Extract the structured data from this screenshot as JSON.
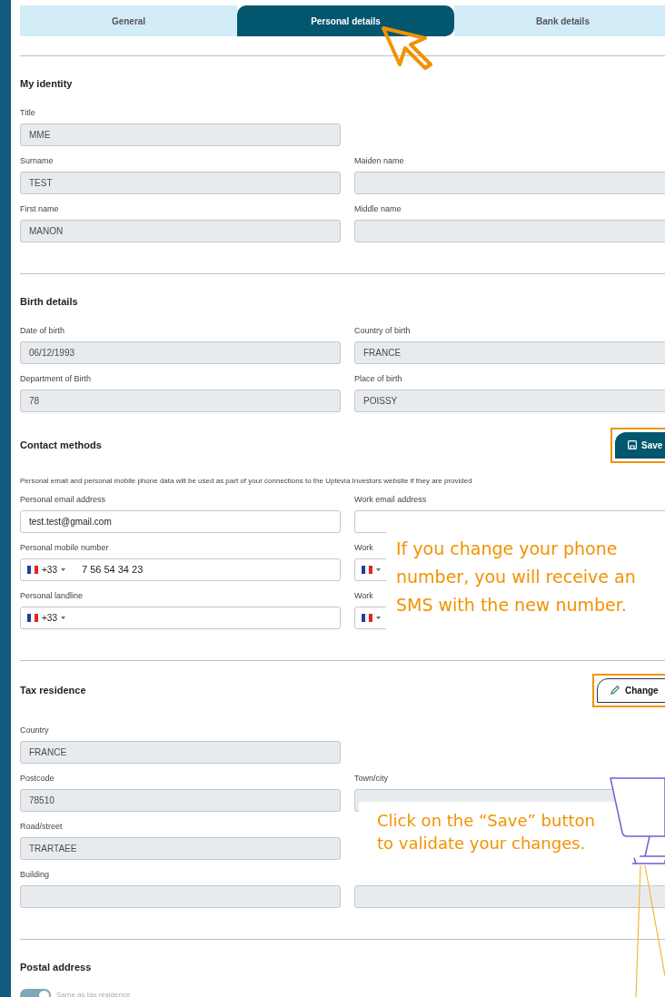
{
  "tabs": [
    {
      "label": "General",
      "selected": false
    },
    {
      "label": "Personal details",
      "selected": true
    },
    {
      "label": "Bank details",
      "selected": false
    }
  ],
  "sections": [
    {
      "title": "My identity",
      "divider": true,
      "rows": [
        {
          "left": {
            "kind": "text",
            "label": "Title",
            "value": "MME",
            "disabled": true
          }
        },
        {
          "left": {
            "kind": "text",
            "label": "Surname",
            "value": "TEST",
            "disabled": true
          },
          "right": {
            "kind": "text",
            "label": "Maiden name",
            "disabled": true
          }
        },
        {
          "left": {
            "kind": "text",
            "label": "First name",
            "value": "MANON",
            "disabled": true
          },
          "right": {
            "kind": "text",
            "label": "Middle name",
            "disabled": true
          }
        }
      ]
    },
    {
      "title": "Birth details",
      "divider": true,
      "rows": [
        {
          "left": {
            "kind": "text",
            "label": "Date of birth",
            "value": "06/12/1993",
            "disabled": true
          },
          "right": {
            "kind": "text",
            "label": "Country of birth",
            "value": "FRANCE",
            "disabled": true
          }
        },
        {
          "left": {
            "kind": "text",
            "label": "Department of Birth",
            "value": "78",
            "disabled": true
          },
          "right": {
            "kind": "text",
            "label": "Place of birth",
            "value": "POISSY",
            "disabled": true
          }
        }
      ]
    },
    {
      "title": "Contact methods",
      "action": {
        "kind": "save",
        "label": "Save",
        "highlighted": true
      },
      "note": "Personal email and personal mobile phone data will be used as part of your connections to the Uptevia Investors website if they are provided",
      "rows": [
        {
          "left": {
            "kind": "text",
            "label": "Personal email address",
            "value": "test.test@gmail.com",
            "disabled": false
          },
          "right": {
            "kind": "text",
            "label": "Work email address",
            "disabled": false
          }
        },
        {
          "left": {
            "kind": "phone",
            "label": "Personal mobile number",
            "dial": "+33",
            "value": "7 56 54 34 23",
            "disabled": false
          },
          "right": {
            "kind": "phone",
            "label": "Work",
            "disabled": false
          }
        },
        {
          "left": {
            "kind": "phone",
            "label": "Personal landline",
            "dial": "+33",
            "disabled": false
          },
          "right": {
            "kind": "phone",
            "label": "Work",
            "disabled": false
          }
        }
      ]
    },
    {
      "title": "Tax residence",
      "divider": true,
      "action": {
        "kind": "change",
        "label": "Change",
        "highlighted": true
      },
      "rows": [
        {
          "left": {
            "kind": "text",
            "label": "Country",
            "value": "FRANCE",
            "disabled": true
          }
        },
        {
          "left": {
            "kind": "text",
            "label": "Postcode",
            "value": "78510",
            "disabled": true
          },
          "right": {
            "kind": "text",
            "label": "Town/city",
            "disabled": true
          }
        },
        {
          "left": {
            "kind": "text",
            "label": "Road/street",
            "value": "TRARTAEE",
            "disabled": true
          }
        },
        {
          "left": {
            "kind": "text",
            "label": "Building",
            "disabled": true
          },
          "right": {
            "kind": "text",
            "disabled": true
          }
        }
      ]
    },
    {
      "title": "Postal address",
      "divider": true,
      "toggle": {
        "label": "Same as tax residence",
        "on": true,
        "disabled": true
      }
    }
  ],
  "annotations": [
    {
      "kind": "cursor"
    },
    {
      "kind": "callout",
      "text": "If you change your phone number, you will receive an SMS with the new number."
    },
    {
      "kind": "callout",
      "text": "Click on the “Save” button to validate your changes."
    },
    {
      "kind": "illustration"
    }
  ]
}
